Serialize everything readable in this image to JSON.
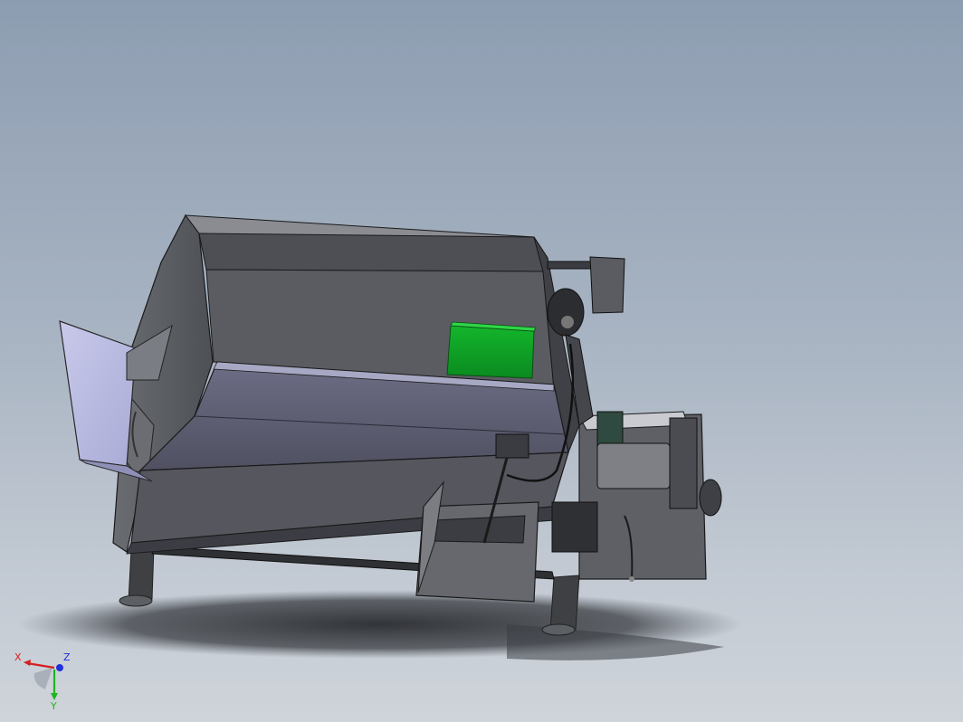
{
  "triad": {
    "x_label": "X",
    "y_label": "Y",
    "z_label": "Z",
    "x_color": "#d42020",
    "y_color": "#1fb51f",
    "z_color": "#2030d8"
  }
}
